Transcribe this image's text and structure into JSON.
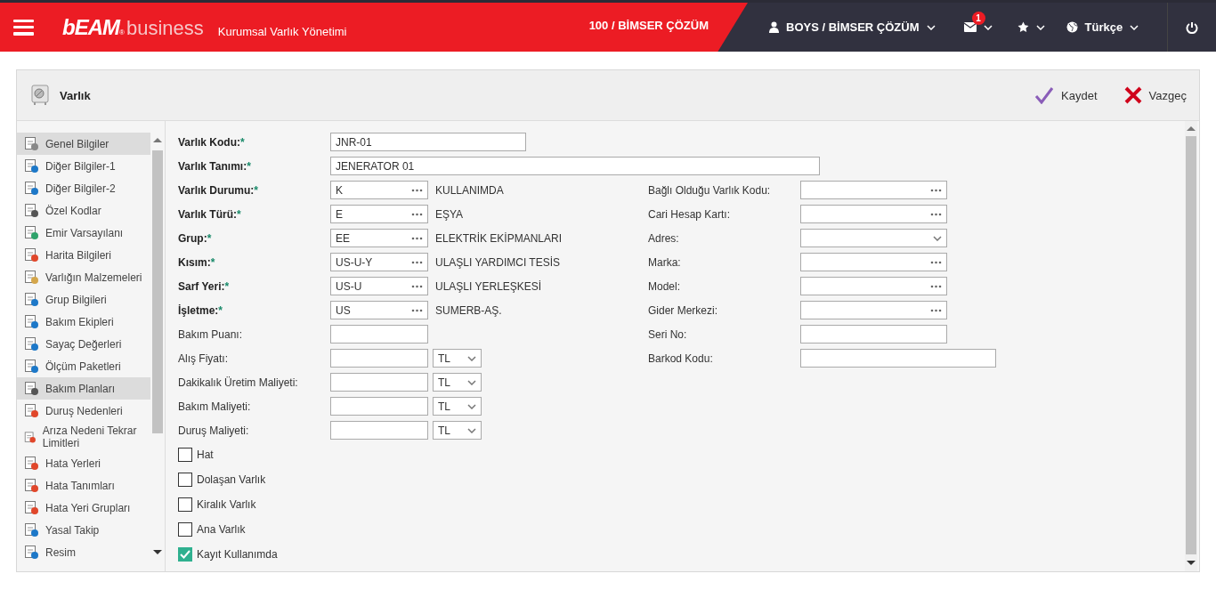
{
  "top_bar": {
    "brand": "bEAM",
    "registered": "®",
    "product": "business",
    "subtitle": "Kurumsal Varlık Yönetimi",
    "company": "100 / BİMSER ÇÖZÜM",
    "user": "BOYS / BİMSER ÇÖZÜM",
    "mail_badge": "1",
    "language": "Türkçe"
  },
  "panel": {
    "title": "Varlık",
    "actions": [
      {
        "kind": "save",
        "label": "Kaydet"
      },
      {
        "kind": "cancel",
        "label": "Vazgeç"
      }
    ]
  },
  "sidebar": {
    "items": [
      {
        "label": "Genel Bilgiler",
        "selected": true
      },
      {
        "label": "Diğer Bilgiler-1",
        "selected": false
      },
      {
        "label": "Diğer Bilgiler-2",
        "selected": false
      },
      {
        "label": "Özel Kodlar",
        "selected": false
      },
      {
        "label": "Emir Varsayılanı",
        "selected": false
      },
      {
        "label": "Harita Bilgileri",
        "selected": false
      },
      {
        "label": "Varlığın Malzemeleri",
        "selected": false
      },
      {
        "label": "Grup Bilgileri",
        "selected": false
      },
      {
        "label": "Bakım Ekipleri",
        "selected": false
      },
      {
        "label": "Sayaç Değerleri",
        "selected": false
      },
      {
        "label": "Ölçüm Paketleri",
        "selected": false
      },
      {
        "label": "Bakım Planları",
        "selected": true
      },
      {
        "label": "Duruş Nedenleri",
        "selected": false
      },
      {
        "label": "Arıza Nedeni Tekrar Limitleri",
        "selected": false
      },
      {
        "label": "Hata Yerleri",
        "selected": false
      },
      {
        "label": "Hata Tanımları",
        "selected": false
      },
      {
        "label": "Hata Yeri Grupları",
        "selected": false
      },
      {
        "label": "Yasal Takip",
        "selected": false
      },
      {
        "label": "Resim",
        "selected": false
      }
    ]
  },
  "form": {
    "top_fields": [
      {
        "label": "Varlık Kodu:",
        "required_mark": "*",
        "value": "JNR-01",
        "kind": "short"
      },
      {
        "label": "Varlık Tanımı:",
        "required_mark": "*",
        "value": "JENERATOR 01",
        "kind": "wide"
      }
    ],
    "left_fields": [
      {
        "kind": "lookup",
        "label": "Varlık Durumu:",
        "required_mark": "*",
        "value": "K",
        "description": "KULLANIMDA"
      },
      {
        "kind": "lookup",
        "label": "Varlık Türü:",
        "required_mark": "*",
        "value": "E",
        "description": "EŞYA"
      },
      {
        "kind": "lookup",
        "label": "Grup:",
        "required_mark": "*",
        "value": "EE",
        "description": "ELEKTRİK EKİPMANLARI"
      },
      {
        "kind": "lookup",
        "label": "Kısım:",
        "required_mark": "*",
        "value": "US-U-Y",
        "description": "ULAŞLI YARDIMCI TESİS"
      },
      {
        "kind": "lookup",
        "label": "Sarf Yeri:",
        "required_mark": "*",
        "value": "US-U",
        "description": "ULAŞLI YERLEŞKESİ"
      },
      {
        "kind": "lookup",
        "label": "İşletme:",
        "required_mark": "*",
        "value": "US",
        "description": "SUMERB-AŞ."
      },
      {
        "kind": "text",
        "label": "Bakım Puanı:"
      },
      {
        "kind": "money",
        "label": "Alış Fiyatı:",
        "currency": "TL"
      },
      {
        "kind": "money",
        "label": "Dakikalık Üretim Maliyeti:",
        "currency": "TL"
      },
      {
        "kind": "money",
        "label": "Bakım Maliyeti:",
        "currency": "TL"
      },
      {
        "kind": "money",
        "label": "Duruş Maliyeti:",
        "currency": "TL"
      }
    ],
    "right_fields": [
      {
        "kind": "lookup",
        "label": "Bağlı Olduğu Varlık Kodu:"
      },
      {
        "kind": "lookup",
        "label": "Cari Hesap Kartı:"
      },
      {
        "kind": "select",
        "label": "Adres:"
      },
      {
        "kind": "lookup",
        "label": "Marka:"
      },
      {
        "kind": "lookup",
        "label": "Model:"
      },
      {
        "kind": "lookup",
        "label": "Gider Merkezi:"
      },
      {
        "kind": "text",
        "label": "Seri No:"
      },
      {
        "kind": "wide",
        "label": "Barkod Kodu:"
      }
    ],
    "checkboxes": [
      {
        "label": "Hat",
        "checked": false
      },
      {
        "label": "Dolaşan Varlık",
        "checked": false
      },
      {
        "label": "Kiralık Varlık",
        "checked": false
      },
      {
        "label": "Ana Varlık",
        "checked": false
      },
      {
        "label": "Kayıt Kullanımda",
        "checked": true
      }
    ]
  }
}
